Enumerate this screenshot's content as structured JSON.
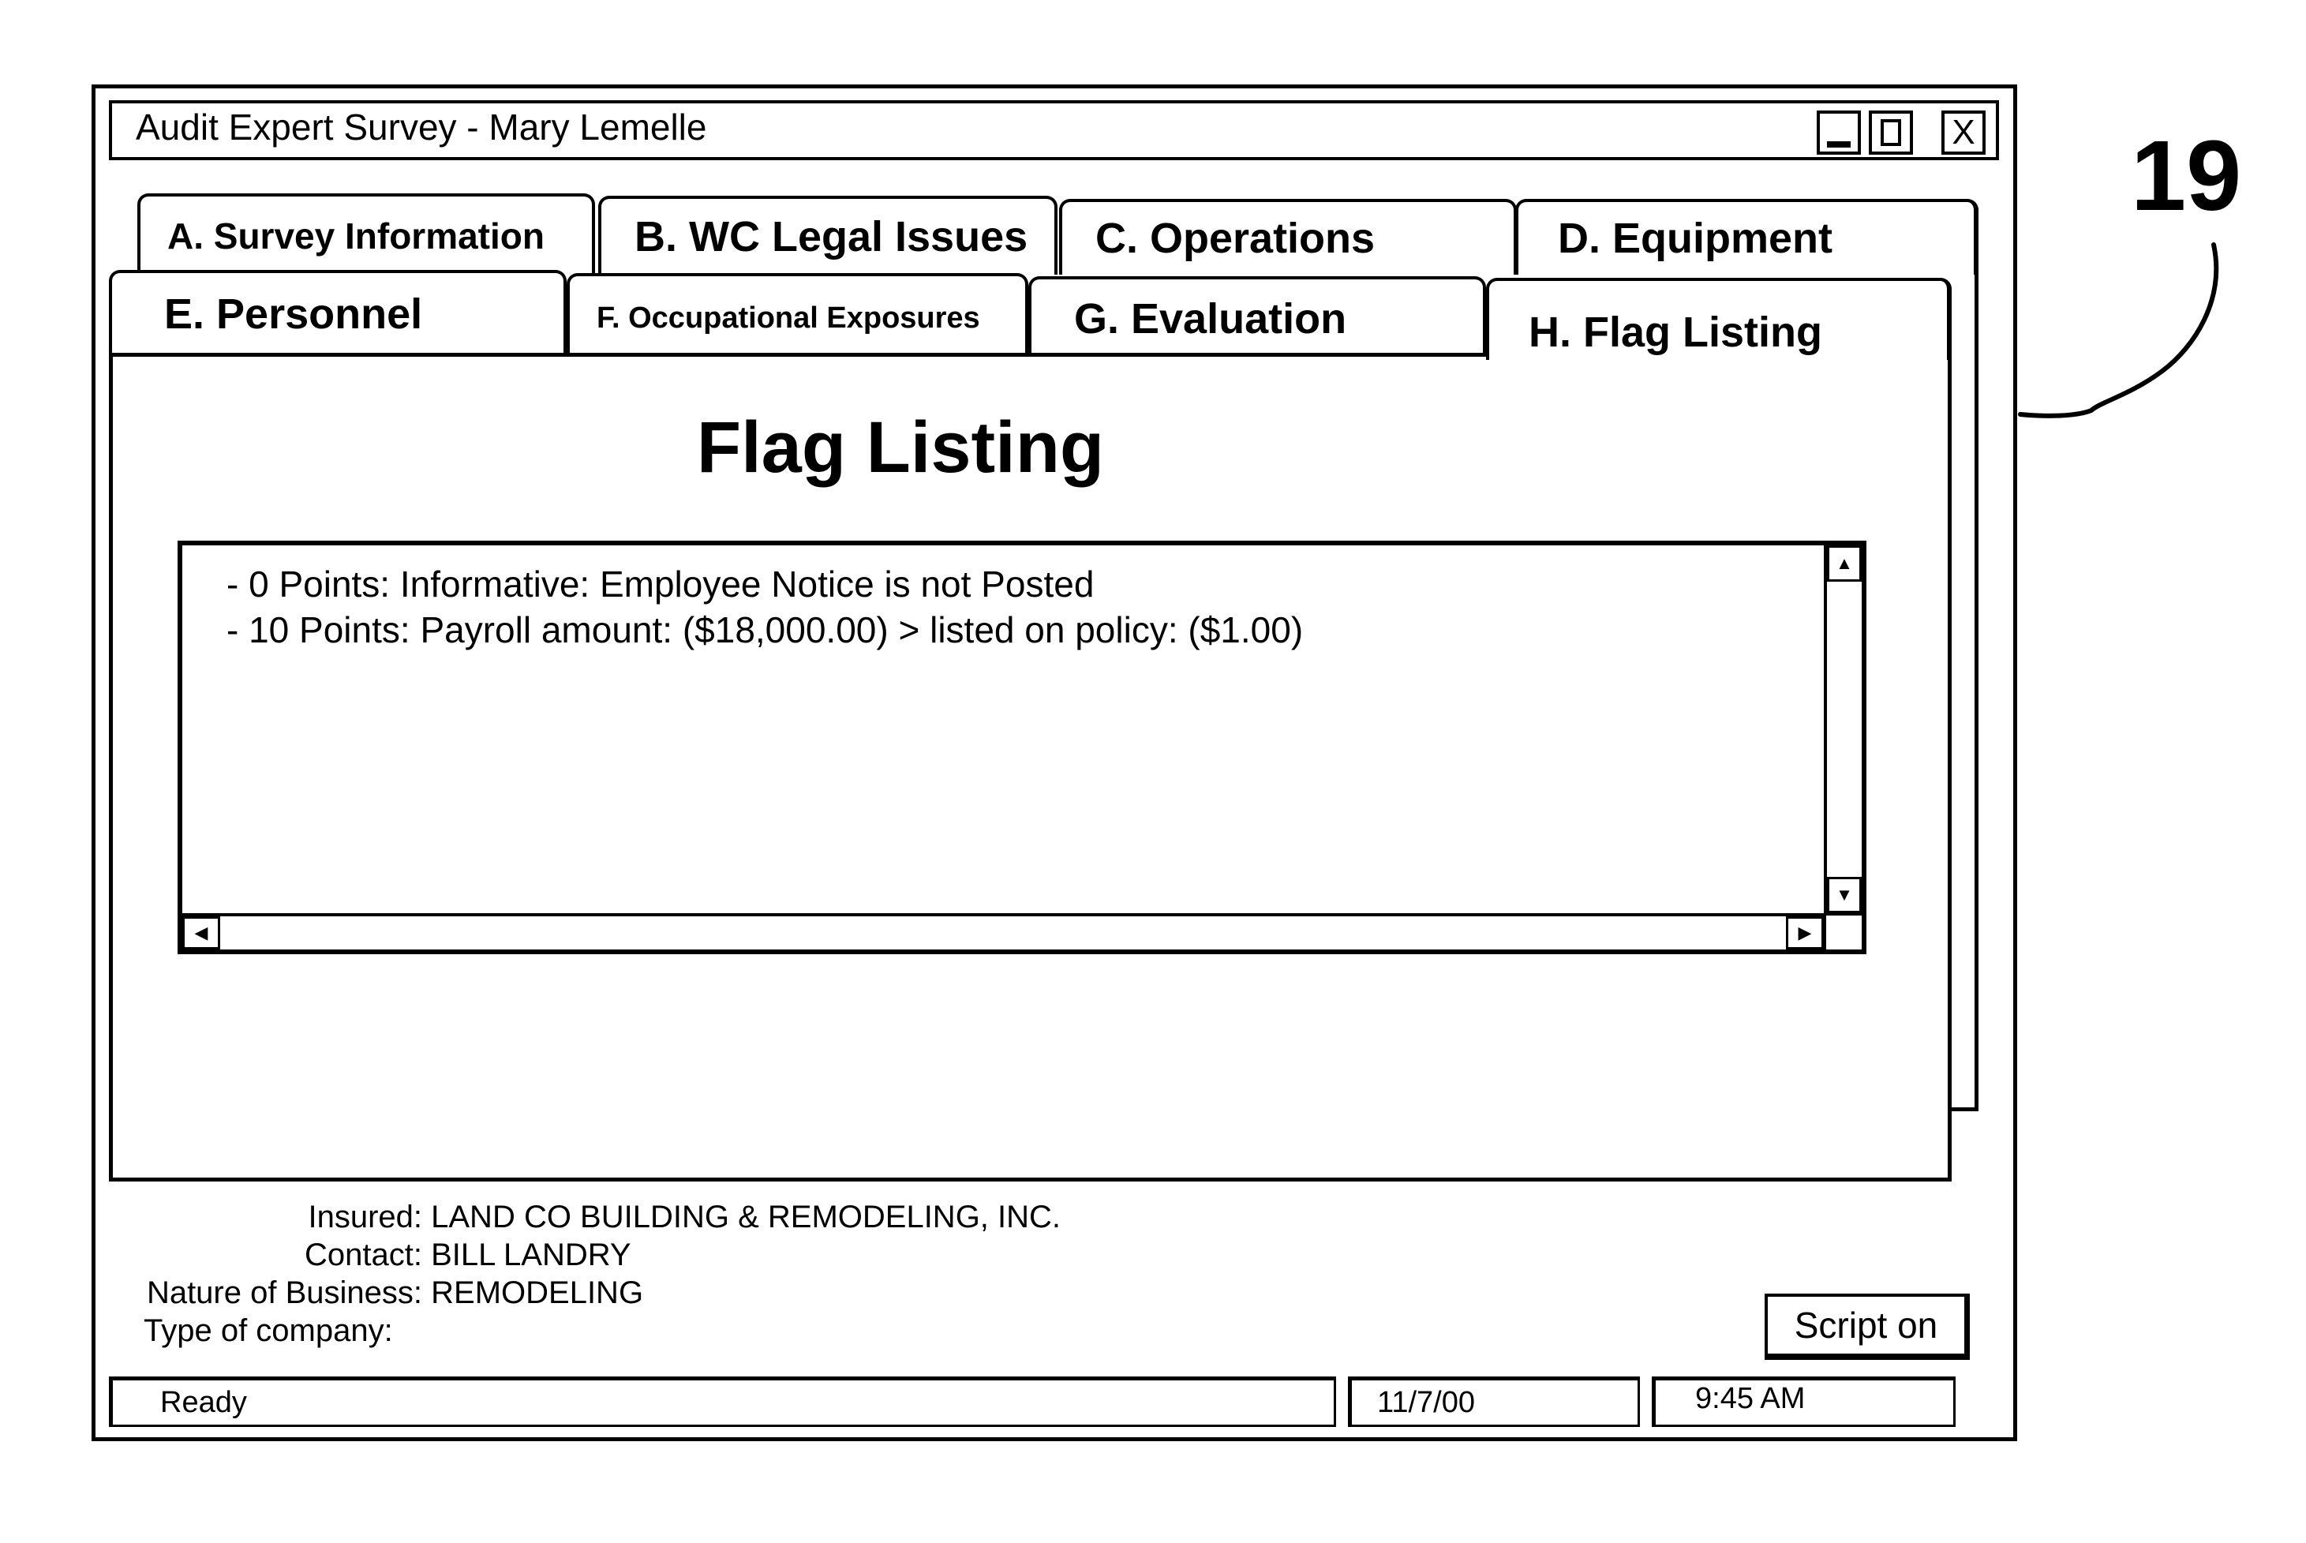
{
  "window": {
    "title": "Audit Expert Survey - Mary Lemelle",
    "controls": {
      "minimize_icon": "minimize-icon",
      "maximize_icon": "maximize-icon",
      "close_icon": "close-icon",
      "close_glyph": "X"
    }
  },
  "tabs": {
    "back_row": [
      {
        "label": "A. Survey Information"
      },
      {
        "label": "B. WC Legal Issues"
      },
      {
        "label": "C. Operations"
      },
      {
        "label": "D. Equipment"
      }
    ],
    "front_row": [
      {
        "label": "E. Personnel"
      },
      {
        "label": "F. Occupational Exposures"
      },
      {
        "label": "G. Evaluation"
      },
      {
        "label": "H. Flag Listing",
        "active": true
      }
    ]
  },
  "panel": {
    "heading": "Flag Listing",
    "flags": [
      "- 0 Points: Informative: Employee Notice is not Posted",
      "- 10 Points: Payroll amount: ($18,000.00) > listed on policy: ($1.00)"
    ],
    "scroll": {
      "up": "▲",
      "down": "▼",
      "left": "◀",
      "right": "▶"
    }
  },
  "info": {
    "insured_label": "Insured:",
    "insured_value": "LAND CO BUILDING & REMODELING, INC.",
    "contact_label": "Contact:",
    "contact_value": "BILL LANDRY",
    "nature_label": "Nature of Business:",
    "nature_value": "REMODELING",
    "type_label": "Type of company:",
    "type_value": ""
  },
  "buttons": {
    "script": "Script on"
  },
  "status_bar": {
    "status": "Ready",
    "date": "11/7/00",
    "time": "9:45 AM"
  },
  "figure": {
    "reference_numeral": "19"
  }
}
